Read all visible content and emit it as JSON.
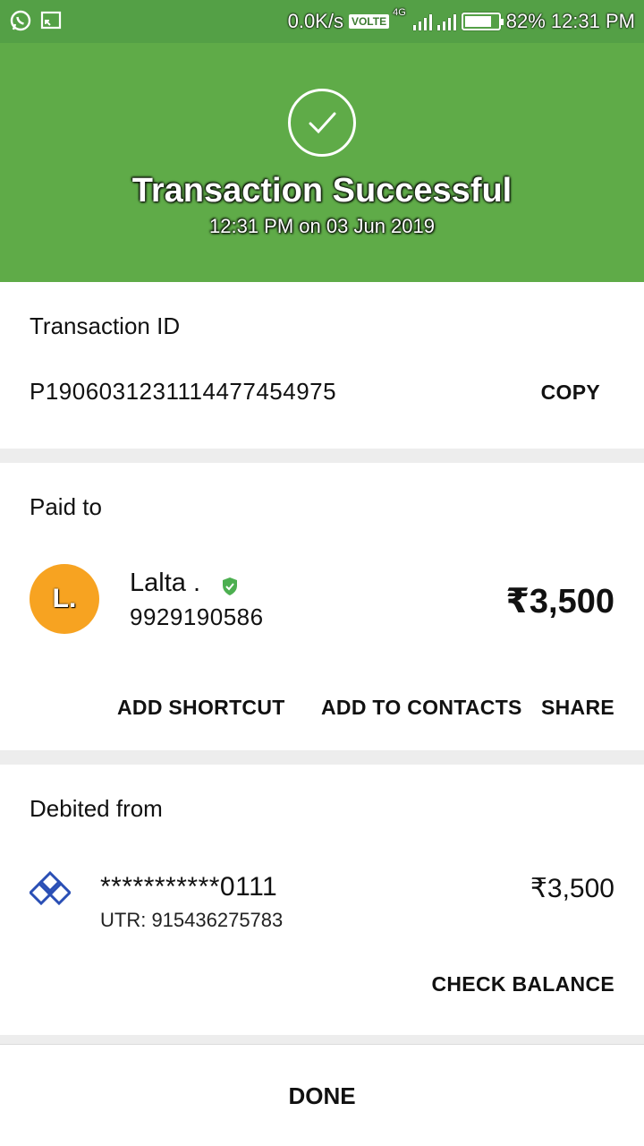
{
  "status_bar": {
    "network_speed": "0.0K/s",
    "volte": "VOLTE",
    "network_type": "4G",
    "battery": "82%",
    "battery_level": 0.82,
    "time": "12:31 PM"
  },
  "header": {
    "title": "Transaction Successful",
    "subtitle": "12:31 PM on 03 Jun 2019",
    "icon": "check-circle-icon"
  },
  "transaction": {
    "label": "Transaction ID",
    "id": "P1906031231114477454975",
    "copy_label": "COPY"
  },
  "paid_to": {
    "label": "Paid to",
    "avatar_letter": "L.",
    "name": "Lalta .",
    "phone": "9929190586",
    "amount": "₹3,500",
    "actions": {
      "add_shortcut": "ADD SHORTCUT",
      "add_to_contacts": "ADD TO CONTACTS",
      "share": "SHARE"
    }
  },
  "debited_from": {
    "label": "Debited from",
    "account": "***********0111",
    "utr": "UTR: 915436275783",
    "amount": "₹3,500",
    "check_balance": "CHECK BALANCE"
  },
  "footer": {
    "done_label": "DONE"
  },
  "colors": {
    "header_green": "#5fab48",
    "status_green": "#54a046",
    "avatar_orange": "#f7a321",
    "verified_green": "#4caf50",
    "bank_blue": "#2a4fb5"
  }
}
